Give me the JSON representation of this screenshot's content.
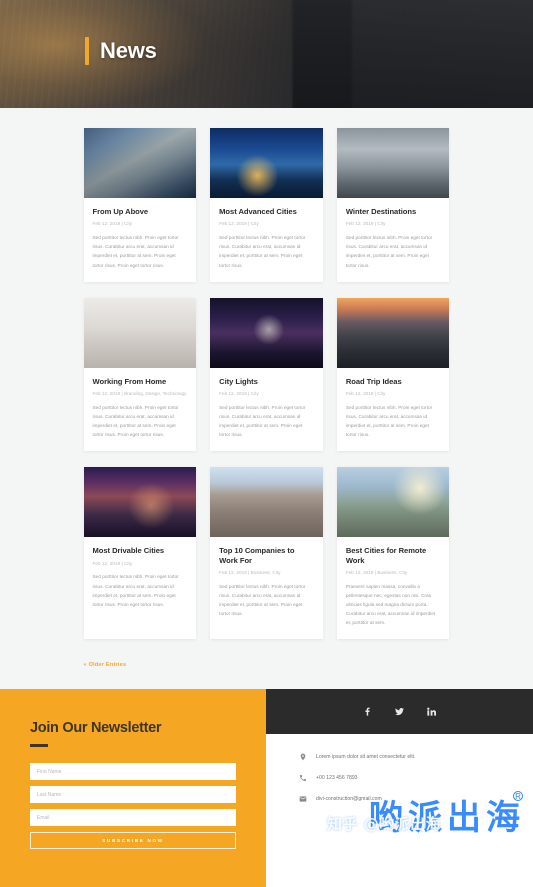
{
  "hero": {
    "title": "News",
    "accent_color": "#f0a830"
  },
  "blog": {
    "posts": [
      {
        "title": "From Up Above",
        "meta": "Feb 12, 2019 | City",
        "excerpt": "Sed porttitor lectus nibh. Proin eget tortor risus. Curabitur arcu erat, accumsan id imperdiet et, porttitor at sem. Proin eget tortor risus. Proin eget tortor risus.",
        "thumb": "aerial-city-skyline"
      },
      {
        "title": "Most Advanced Cities",
        "meta": "Feb 12, 2019 | City",
        "excerpt": "Sed porttitor lectus nibh. Proin eget tortor risus. Curabitur arcu erat, accumsan id imperdiet et, porttitor at sem. Proin eget tortor risus.",
        "thumb": "night-skyscrapers-river"
      },
      {
        "title": "Winter Destinations",
        "meta": "Feb 12, 2019 | City",
        "excerpt": "Sed porttitor lectus nibh. Proin eget tortor risus. Curabitur arcu erat, accumsan id imperdiet et, porttitor at sem. Proin eget tortor risus.",
        "thumb": "winter-aerial-monument"
      },
      {
        "title": "Working From Home",
        "meta": "Feb 12, 2019 | Branding, Design, Technology",
        "excerpt": "Sed porttitor lectus nibh. Proin eget tortor risus. Curabitur arcu erat, accumsan id imperdiet et, porttitor at sem. Proin eget tortor risus. Proin eget tortor risus.",
        "thumb": "home-desk-window"
      },
      {
        "title": "City Lights",
        "meta": "Feb 12, 2019 | City",
        "excerpt": "Sed porttitor lectus nibh. Proin eget tortor risus. Curabitur arcu erat, accumsan id imperdiet et, porttitor at sem. Proin eget tortor risus.",
        "thumb": "night-capitol-light-trails"
      },
      {
        "title": "Road Trip Ideas",
        "meta": "Feb 12, 2019 | City",
        "excerpt": "Sed porttitor lectus nibh. Proin eget tortor risus. Curabitur arcu erat, accumsan id imperdiet et, porttitor at sem. Proin eget tortor risus.",
        "thumb": "highway-interchange-sunset"
      },
      {
        "title": "Most Drivable Cities",
        "meta": "Feb 12, 2019 | City",
        "excerpt": "Sed porttitor lectus nibh. Proin eget tortor risus. Curabitur arcu erat, accumsan id imperdiet et, porttitor at sem. Proin eget tortor risus. Proin eget tortor risus.",
        "thumb": "dusk-city-light-trails"
      },
      {
        "title": "Top 10 Companies to Work For",
        "meta": "Feb 12, 2019 | Business, City",
        "excerpt": "Sed porttitor lectus nibh. Proin eget tortor risus. Curabitur arcu erat, accumsan id imperdiet et, porttitor at sem. Proin eget tortor risus.",
        "thumb": "classic-building-facade"
      },
      {
        "title": "Best Cities for Remote Work",
        "meta": "Feb 12, 2019 | Business, City",
        "excerpt": "Praesent sapien massa, convallis a pellentesque nec, egestas non nisi. Cras ultricies ligula sed magna dictum porta. Curabitur arcu erat, accumsan id imperdiet et, porttitor at sem.",
        "thumb": "sunny-street-palms"
      }
    ],
    "older_entries_label": "« Older Entries"
  },
  "newsletter": {
    "title": "Join Our Newsletter",
    "first_name_placeholder": "First Name",
    "last_name_placeholder": "Last Name",
    "email_placeholder": "Email",
    "first_name_value": "",
    "last_name_value": "",
    "email_value": "",
    "submit_label": "SUBSCRIBE NOW",
    "background_color": "#f5a623"
  },
  "footer": {
    "social": [
      {
        "name": "facebook-icon"
      },
      {
        "name": "twitter-icon"
      },
      {
        "name": "linkedin-icon"
      }
    ],
    "contacts": [
      {
        "icon": "location-pin-icon",
        "text": "Lorem ipsum dolor sit amet consectetur elit."
      },
      {
        "icon": "phone-icon",
        "text": "+00 123 456 7893"
      },
      {
        "icon": "envelope-icon",
        "text": "divi-construction@gmail.com"
      }
    ],
    "social_bar_color": "#2b2b2b"
  },
  "watermark": {
    "logo_text": "哟派出海",
    "registered_mark": "R",
    "overlay_text": "知乎 @哟派出海",
    "color": "#2f86ff"
  }
}
